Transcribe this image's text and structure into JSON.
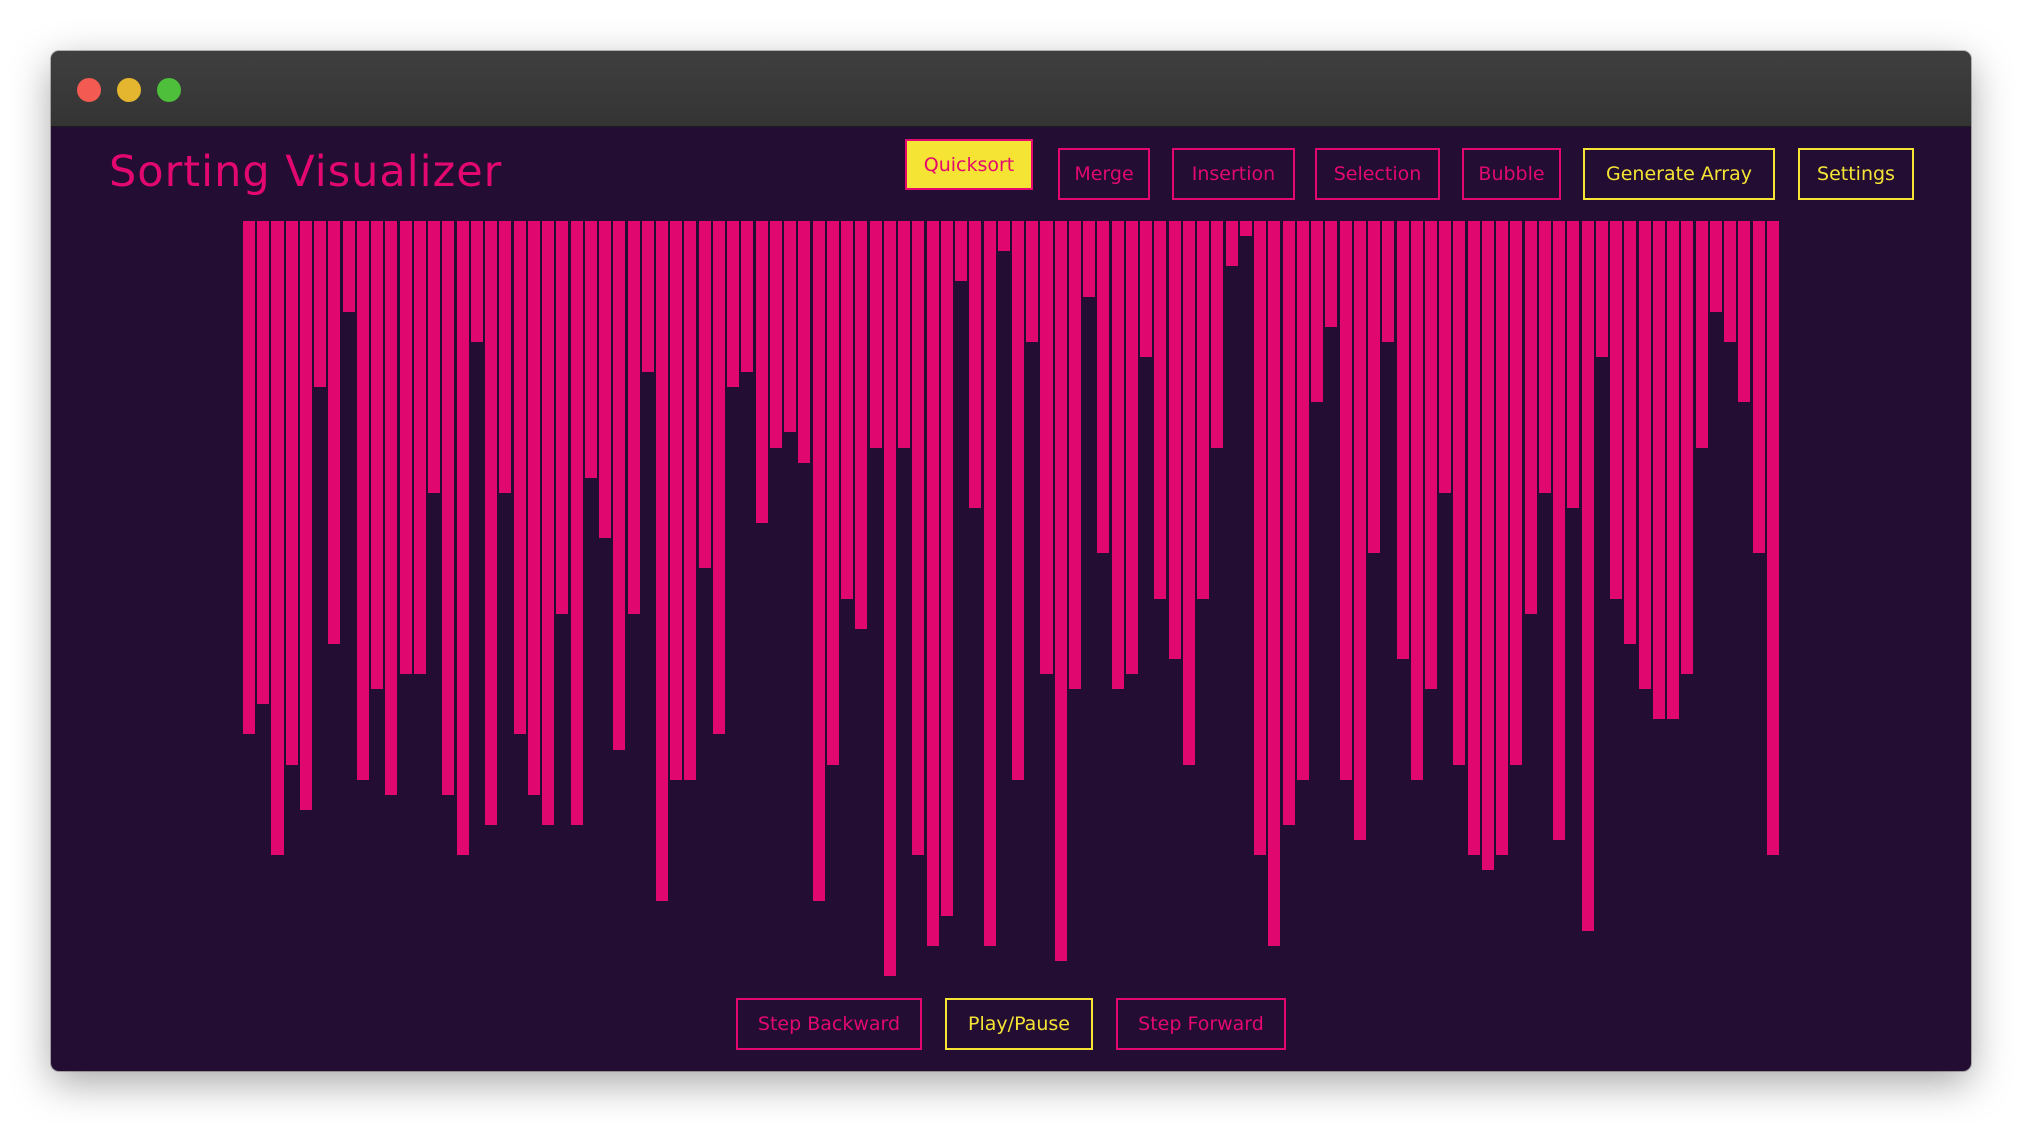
{
  "window": {
    "traffic_lights": {
      "close": "#f25a52",
      "minimize": "#e4b52e",
      "maximize": "#4dbf3a"
    }
  },
  "app": {
    "title": "Sorting Visualizer",
    "colors": {
      "background": "#230d33",
      "accent": "#e3086f",
      "highlight": "#f5e434",
      "bar": "#e0086e"
    }
  },
  "nav": {
    "quicksort": "Quicksort",
    "merge": "Merge",
    "insertion": "Insertion",
    "selection": "Selection",
    "bubble": "Bubble",
    "generate_array": "Generate Array",
    "settings": "Settings",
    "active_algorithm": "Quicksort"
  },
  "controls": {
    "step_backward": "Step Backward",
    "play_pause": "Play/Pause",
    "step_forward": "Step Forward"
  },
  "array": {
    "max_value": 100,
    "values": [
      68,
      64,
      84,
      72,
      78,
      22,
      56,
      12,
      74,
      62,
      76,
      60,
      60,
      36,
      76,
      84,
      16,
      80,
      36,
      68,
      76,
      80,
      52,
      80,
      34,
      42,
      70,
      52,
      20,
      90,
      74,
      74,
      46,
      68,
      22,
      20,
      40,
      30,
      28,
      32,
      90,
      72,
      50,
      54,
      30,
      100,
      30,
      84,
      96,
      92,
      8,
      38,
      96,
      4,
      74,
      16,
      60,
      98,
      62,
      10,
      44,
      62,
      60,
      18,
      50,
      58,
      72,
      50,
      30,
      6,
      2,
      84,
      96,
      80,
      74,
      24,
      14,
      74,
      82,
      44,
      16,
      58,
      74,
      62,
      36,
      72,
      84,
      86,
      84,
      72,
      52,
      36,
      82,
      38,
      94,
      18,
      50,
      56,
      62,
      66,
      66,
      60,
      30,
      12,
      16,
      24,
      44,
      84
    ]
  }
}
